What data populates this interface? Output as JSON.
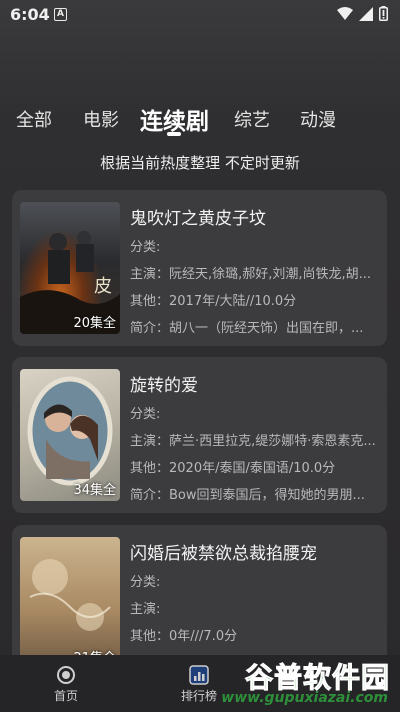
{
  "status_bar": {
    "time": "6:04",
    "badge": "A"
  },
  "tabs": [
    {
      "label": "全部",
      "active": false
    },
    {
      "label": "电影",
      "active": false
    },
    {
      "label": "连续剧",
      "active": true
    },
    {
      "label": "综艺",
      "active": false
    },
    {
      "label": "动漫",
      "active": false
    }
  ],
  "subtitle": "根据当前热度整理 不定时更新",
  "cards": [
    {
      "title": "鬼吹灯之黄皮子坟",
      "category": "分类:",
      "cast": "主演：阮经天,徐璐,郝好,刘潮,尚铁龙,胡...",
      "other": "其他：2017年/大陆//10.0分",
      "intro": "简介：胡八一（阮经天饰）出国在即，...",
      "episodes": "20集全"
    },
    {
      "title": "旋转的爱",
      "category": "分类:",
      "cast": "主演：萨兰·西里拉克,缇莎娜特·索恩素克...",
      "other": "其他：2020年/泰国/泰国语/10.0分",
      "intro": "简介：Bow回到泰国后，得知她的男朋...",
      "episodes": "34集全"
    },
    {
      "title": "闪婚后被禁欲总裁掐腰宠",
      "category": "分类:",
      "cast": "主演:",
      "other": "其他：0年///7.0分",
      "intro": "",
      "episodes": "21集全"
    }
  ],
  "bottom_nav": [
    {
      "label": "首页",
      "icon": "home-icon"
    },
    {
      "label": "排行榜",
      "icon": "ranking-icon"
    }
  ],
  "watermark": {
    "top": "谷普软件园",
    "bottom": "www.gupuxiazai.com"
  }
}
